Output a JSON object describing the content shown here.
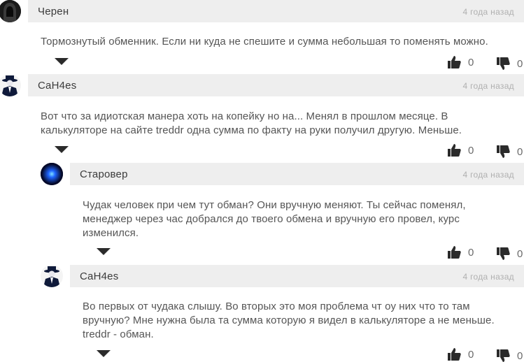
{
  "comments": [
    {
      "author": "Черен",
      "date": "4 года назад",
      "text": "Тормознутый обменник. Если ни куда не спешите и сумма небольшая то поменять можно.",
      "likes": "0",
      "dislikes": "0",
      "avatar": "dark-hooded-figure"
    },
    {
      "author": "CaH4es",
      "date": "4 года назад",
      "text": "Вот что за идиотская манера хоть на копейку но на... Менял в прошлом месяце. В калькуляторе на сайте treddr одна сумма по факту на руки получил другую. Меньше.",
      "likes": "0",
      "dislikes": "0",
      "avatar": "anonymous-suit-figure"
    },
    {
      "author": "Старовер",
      "date": "4 года назад",
      "text": "Чудак человек при чем тут обман? Они вручную меняют. Ты сейчас поменял, менеджер через час добрался до твоего обмена и вручную его провел, курс изменился.",
      "likes": "0",
      "dislikes": "0",
      "avatar": "blue-orb"
    },
    {
      "author": "CaH4es",
      "date": "4 года назад",
      "text": "Во первых от чудака слышу. Во вторых это моя проблема чт оу них что то там вручную? Мне нужна была та сумма которую я видел в калькуляторе а не меньше. treddr - обман.",
      "likes": "0",
      "dislikes": "0",
      "avatar": "anonymous-suit-figure"
    }
  ],
  "colors": {
    "header_bg": "#eeeeee",
    "date_text": "#b0b0b0",
    "icon": "#2b2b2b"
  }
}
